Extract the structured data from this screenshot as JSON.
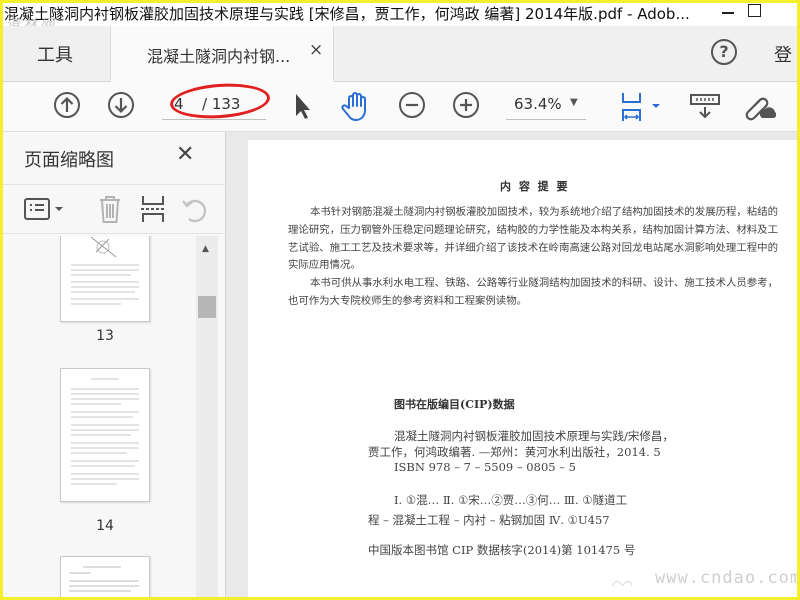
{
  "window": {
    "title": "混凝土隧洞内衬钢板灌胶加固技术原理与实践 [宋修昌，贾工作，何鸿政 编著] 2014年版.pdf - Adob...",
    "watermark": "道林网"
  },
  "tabs": {
    "tools_label": "工具",
    "doc_label": "混凝土隧洞内衬钢...",
    "close_glyph": "×",
    "help_glyph": "?",
    "login_label": "登"
  },
  "toolbar": {
    "page_current": "4",
    "page_total": "/ 133",
    "zoom_value": "63.4%"
  },
  "sidebar": {
    "header": "页面缩略图",
    "close_glyph": "✕",
    "thumbnails": [
      {
        "label": "13"
      },
      {
        "label": "14"
      }
    ]
  },
  "document": {
    "heading": "内 容 提 要",
    "para1": "本书针对钢筋混凝土隧洞内衬钢板灌胶加固技术，较为系统地介绍了结构加固技术的发展历程，粘结的理论研究，压力钢管外压稳定问题理论研究，结构胶的力学性能及本构关系，结构加固计算方法、材料及工艺试验、施工工艺及技术要求等，并详细介绍了该技术在岭南高速公路对回龙电站尾水洞影响处理工程中的实际应用情况。",
    "para2": "本书可供从事水利水电工程、铁路、公路等行业隧洞结构加固技术的科研、设计、施工技术人员参考，也可作为大专院校师生的参考资料和工程案例读物。",
    "cip_heading": "图书在版编目(CIP)数据",
    "cip_line1": "混凝土隧洞内衬钢板灌胶加固技术原理与实践/宋修昌，",
    "cip_line2": "贾工作，何鸿政编著. —郑州：黄河水利出版社，2014. 5",
    "cip_line3": "ISBN 978 – 7 – 5509 – 0805 – 5",
    "cip_line4": "Ⅰ. ①混…   Ⅱ. ①宋…②贾…③何…   Ⅲ. ①隧道工",
    "cip_line5": "程 – 混凝土工程 – 内衬 – 粘钢加固   Ⅳ. ①U457",
    "cip_line6": "中国版本图书馆 CIP 数据核字(2014)第 101475 号",
    "site_watermark": "www.cndao.com"
  },
  "colors": {
    "accent_blue": "#2a6fd6",
    "highlight_red": "#e02020",
    "frame_yellow": "#f3ef2a"
  },
  "icons": {
    "toolbar": [
      "arrow-up-circle-icon",
      "arrow-down-circle-icon",
      "cursor-icon",
      "hand-icon",
      "zoom-out-icon",
      "zoom-in-icon",
      "fit-page-icon",
      "scroll-mode-icon",
      "share-link-icon"
    ],
    "sidebar": [
      "thumbnail-options-icon",
      "trash-icon",
      "insert-page-icon",
      "rotate-icon"
    ]
  }
}
